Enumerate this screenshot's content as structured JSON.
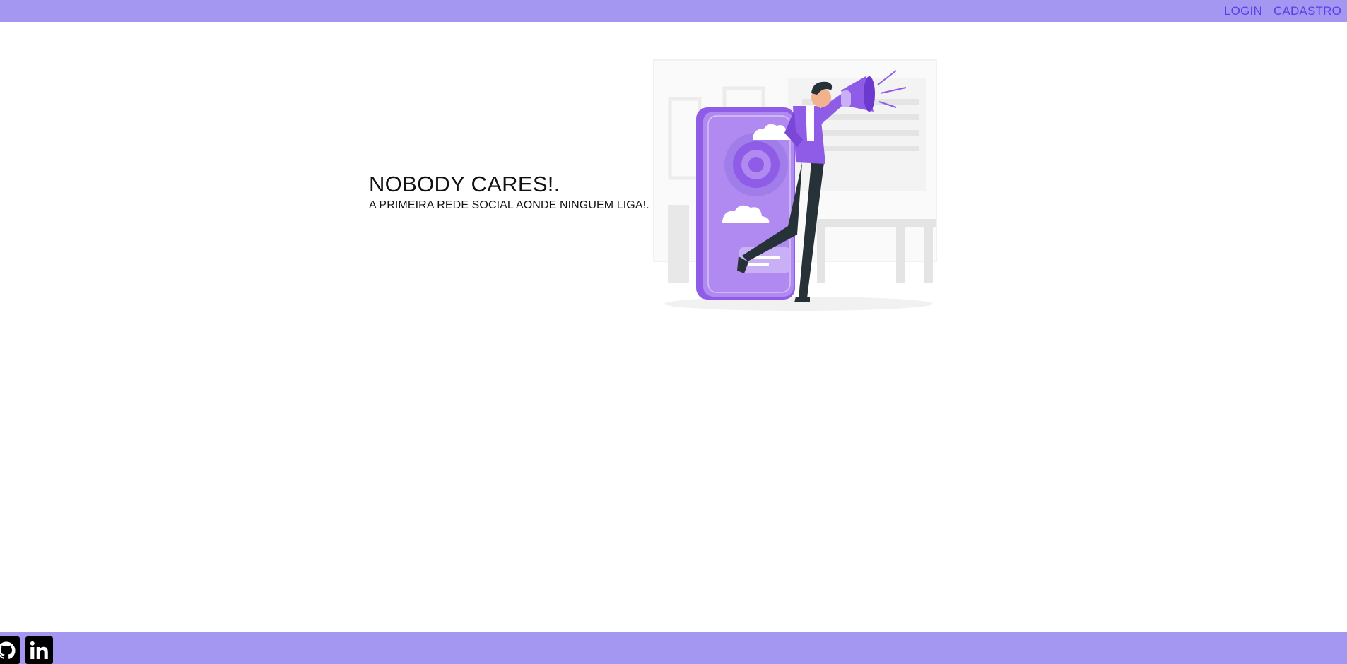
{
  "nav": {
    "login_label": "LOGIN",
    "signup_label": "CADASTRO"
  },
  "hero": {
    "title": "NOBODY CARES!.",
    "subtitle": "A PRIMEIRA REDE SOCIAL AONDE NINGUEM LIGA!."
  },
  "illustration": {
    "icon": "man-with-megaphone-and-phone-illustration"
  },
  "footer": {
    "links": [
      {
        "icon": "github-icon"
      },
      {
        "icon": "linkedin-icon"
      }
    ]
  },
  "colors": {
    "bar_background": "#a397f1",
    "nav_link": "#5a3ee6",
    "accent_purple": "#8f5ce8",
    "text": "#111111"
  }
}
